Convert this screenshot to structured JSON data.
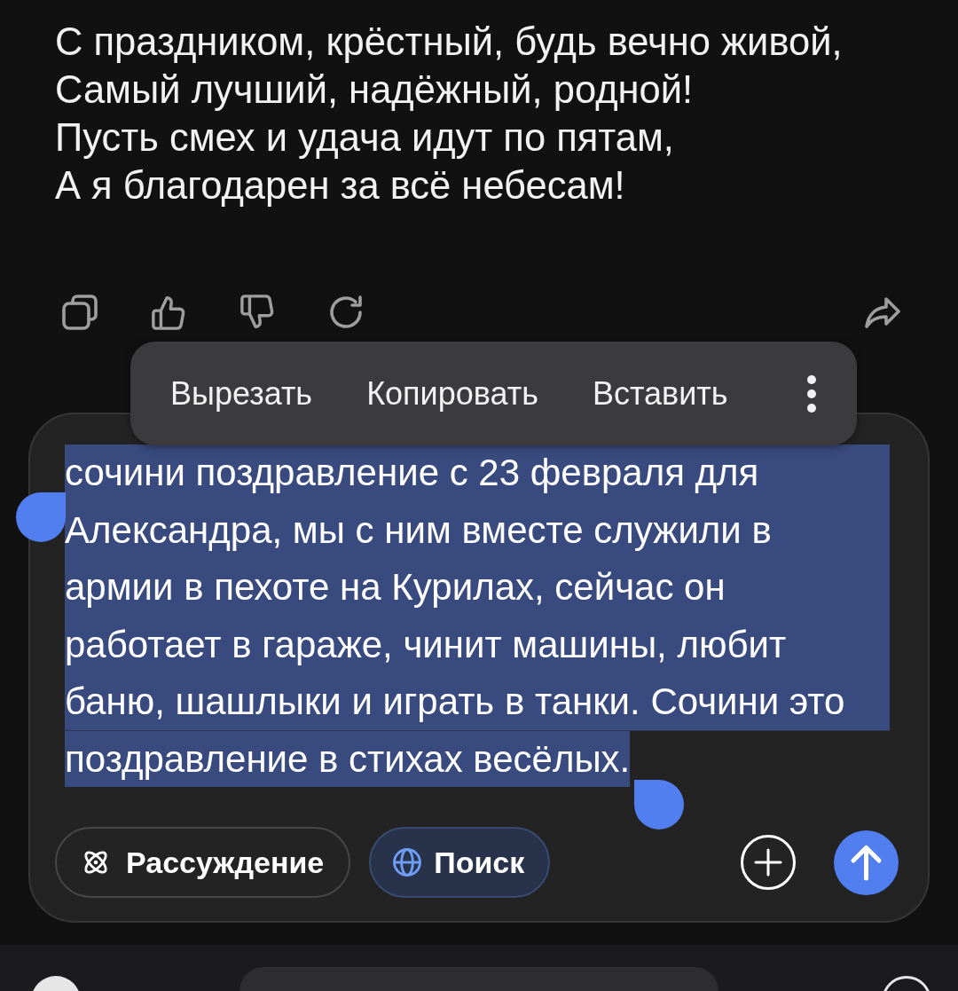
{
  "poem": {
    "lines": [
      "С праздником, крёстный, будь вечно живой,",
      "Самый лучший, надёжный, родной!",
      "Пусть смех и удача идут по пятам,",
      "А я благодарен за всё небесам!"
    ]
  },
  "context_menu": {
    "items": [
      "Вырезать",
      "Копировать",
      "Вставить"
    ]
  },
  "composer": {
    "value": "сочини поздравление с 23 февраля для Александра, мы с ним вместе служили в армии в пехоте на Курилах, сейчас он работает в гараже, чинит машины, любит баню, шашлыки и играть в танки. Сочини это поздравление в стихах весёлых.",
    "text_selected": true,
    "toggles": [
      {
        "kind": "reasoning",
        "label": "Рассуждение",
        "on": false
      },
      {
        "kind": "search",
        "label": "Поиск",
        "on": true
      }
    ]
  }
}
